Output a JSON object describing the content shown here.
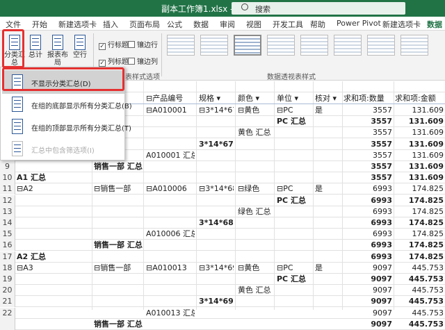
{
  "titlebar": {
    "title": "副本工作簿1.xlsx  -  Excel",
    "search_placeholder": "搜索"
  },
  "menu": [
    "文件",
    "开始",
    "新建选项卡",
    "插入",
    "页面布局",
    "公式",
    "数据",
    "审阅",
    "视图",
    "开发工具",
    "帮助",
    "Power Pivot",
    "新建选项卡",
    "数据"
  ],
  "ribbon": {
    "buttons": [
      "分类汇总",
      "总计",
      "报表布局",
      "空行"
    ],
    "checks": [
      {
        "label": "行标题",
        "checked": true
      },
      {
        "label": "列标题",
        "checked": true
      },
      {
        "label": "镶边行",
        "checked": false
      },
      {
        "label": "镶边列",
        "checked": false
      }
    ],
    "group_style_options": "表样式选项",
    "group_pivot_styles": "数据透视表样式"
  },
  "dropdown": {
    "items": [
      {
        "label": "不显示分类汇总(D)",
        "highlighted": true,
        "disabled": false
      },
      {
        "label": "在组的底部显示所有分类汇总(B)",
        "highlighted": false,
        "disabled": false
      },
      {
        "label": "在组的顶部显示所有分类汇总(T)",
        "highlighted": false,
        "disabled": false
      },
      {
        "label": "汇总中包含筛选项(I)",
        "highlighted": false,
        "disabled": true
      }
    ]
  },
  "headers": {
    "product_code": "产品编号",
    "spec": "规格",
    "color": "颜色",
    "unit": "单位",
    "check": "核对",
    "sum_qty": "求和项:数量",
    "sum_amount": "求和项:金额"
  },
  "rows": [
    {
      "n": "",
      "a": "",
      "b": "部",
      "c": "⊟A010001",
      "d": "⊟3*14*67",
      "e": "⊟黄色",
      "f": "⊟PC",
      "g": "是",
      "h": "3557",
      "i": "131.609",
      "bold": false
    },
    {
      "n": "",
      "a": "",
      "b": "",
      "c": "",
      "d": "",
      "e": "",
      "f": "PC 汇总",
      "g": "",
      "h": "3557",
      "i": "131.609",
      "bold": true
    },
    {
      "n": "",
      "a": "",
      "b": "",
      "c": "",
      "d": "",
      "e": "黄色 汇总",
      "f": "",
      "g": "",
      "h": "3557",
      "i": "131.609",
      "bold": false
    },
    {
      "n": "",
      "a": "",
      "b": "",
      "c": "",
      "d": "3*14*67 汇总",
      "e": "",
      "f": "",
      "g": "",
      "h": "3557",
      "i": "131.609",
      "bold": true
    },
    {
      "n": "",
      "a": "",
      "b": "",
      "c": "A010001 汇总",
      "d": "",
      "e": "",
      "f": "",
      "g": "",
      "h": "3557",
      "i": "131.609",
      "bold": false
    },
    {
      "n": "9",
      "a": "",
      "b": "销售一部 汇总",
      "c": "",
      "d": "",
      "e": "",
      "f": "",
      "g": "",
      "h": "3557",
      "i": "131.609",
      "bold": true
    },
    {
      "n": "10",
      "a": "A1 汇总",
      "b": "",
      "c": "",
      "d": "",
      "e": "",
      "f": "",
      "g": "",
      "h": "3557",
      "i": "131.609",
      "bold": true
    },
    {
      "n": "11",
      "a": "⊟A2",
      "b": "⊟销售一部",
      "c": "⊟A010006",
      "d": "⊟3*14*68",
      "e": "⊟绿色",
      "f": "⊟PC",
      "g": "是",
      "h": "6993",
      "i": "174.825",
      "bold": false
    },
    {
      "n": "12",
      "a": "",
      "b": "",
      "c": "",
      "d": "",
      "e": "",
      "f": "PC 汇总",
      "g": "",
      "h": "6993",
      "i": "174.825",
      "bold": true
    },
    {
      "n": "13",
      "a": "",
      "b": "",
      "c": "",
      "d": "",
      "e": "绿色 汇总",
      "f": "",
      "g": "",
      "h": "6993",
      "i": "174.825",
      "bold": false
    },
    {
      "n": "14",
      "a": "",
      "b": "",
      "c": "",
      "d": "3*14*68 汇总",
      "e": "",
      "f": "",
      "g": "",
      "h": "6993",
      "i": "174.825",
      "bold": true
    },
    {
      "n": "15",
      "a": "",
      "b": "",
      "c": "A010006 汇总",
      "d": "",
      "e": "",
      "f": "",
      "g": "",
      "h": "6993",
      "i": "174.825",
      "bold": false
    },
    {
      "n": "16",
      "a": "",
      "b": "销售一部 汇总",
      "c": "",
      "d": "",
      "e": "",
      "f": "",
      "g": "",
      "h": "6993",
      "i": "174.825",
      "bold": true
    },
    {
      "n": "17",
      "a": "A2 汇总",
      "b": "",
      "c": "",
      "d": "",
      "e": "",
      "f": "",
      "g": "",
      "h": "6993",
      "i": "174.825",
      "bold": true
    },
    {
      "n": "18",
      "a": "⊟A3",
      "b": "⊟销售一部",
      "c": "⊟A010013",
      "d": "⊟3*14*69",
      "e": "⊟黄色",
      "f": "⊟PC",
      "g": "是",
      "h": "9097",
      "i": "445.753",
      "bold": false
    },
    {
      "n": "19",
      "a": "",
      "b": "",
      "c": "",
      "d": "",
      "e": "",
      "f": "PC 汇总",
      "g": "",
      "h": "9097",
      "i": "445.753",
      "bold": true
    },
    {
      "n": "20",
      "a": "",
      "b": "",
      "c": "",
      "d": "",
      "e": "黄色 汇总",
      "f": "",
      "g": "",
      "h": "9097",
      "i": "445.753",
      "bold": false
    },
    {
      "n": "21",
      "a": "",
      "b": "",
      "c": "",
      "d": "3*14*69 汇总",
      "e": "",
      "f": "",
      "g": "",
      "h": "9097",
      "i": "445.753",
      "bold": true
    },
    {
      "n": "22",
      "a": "",
      "b": "",
      "c": "A010013 汇总",
      "d": "",
      "e": "",
      "f": "",
      "g": "",
      "h": "9097",
      "i": "445.753",
      "bold": false
    },
    {
      "n": "",
      "a": "",
      "b": "销售一部 汇总",
      "c": "",
      "d": "",
      "e": "",
      "f": "",
      "g": "",
      "h": "9097",
      "i": "445.753",
      "bold": true
    }
  ]
}
